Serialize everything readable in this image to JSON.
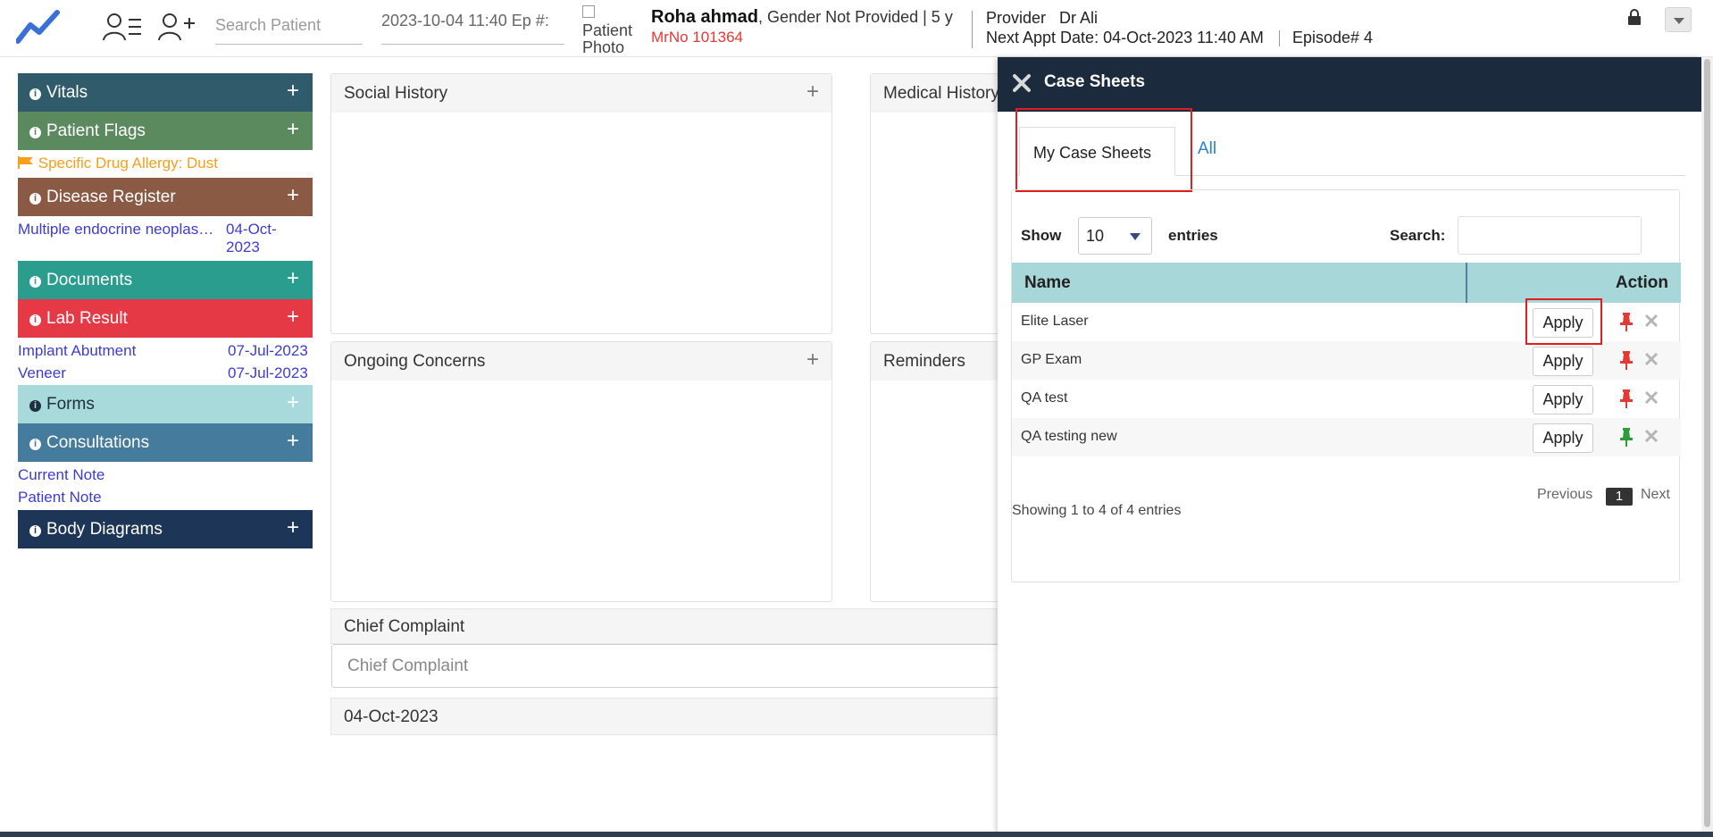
{
  "header": {
    "search_placeholder": "Search Patient",
    "ep_text": "2023-10-04 11:40 Ep #:",
    "photo_alt": "Patient Photo",
    "patient_name": "Roha ahmad",
    "patient_meta": ", Gender Not Provided | 5 y",
    "mrno": "MrNo 101364",
    "provider_label": "Provider",
    "provider_name": "Dr Ali",
    "next_appt": "Next Appt Date: 04-Oct-2023 11:40 AM",
    "episode": "Episode# 4"
  },
  "left": {
    "vitals": "Vitals",
    "flags": "Patient Flags",
    "flag_item": "Specific Drug Allergy: Dust",
    "disease": "Disease Register",
    "disease_item": "Multiple endocrine neoplas…",
    "disease_date": "04-Oct-\n2023",
    "documents": "Documents",
    "lab": "Lab Result",
    "lab_items": [
      {
        "name": "Implant Abutment",
        "date": "07-Jul-2023"
      },
      {
        "name": "Veneer",
        "date": "07-Jul-2023"
      }
    ],
    "forms": "Forms",
    "consult": "Consultations",
    "consult_items": [
      "Current Note",
      "Patient Note"
    ],
    "body": "Body Diagrams",
    "colors": {
      "vitals": "#2f5b6b",
      "flags": "#5b8a5e",
      "disease": "#8b5a45",
      "documents": "#2a9d8f",
      "lab": "#e63946",
      "forms": "#a8dadc",
      "consult": "#457b9d",
      "body": "#1d3557"
    }
  },
  "center": {
    "social": "Social History",
    "medical": "Medical History",
    "ongoing": "Ongoing Concerns",
    "reminders": "Reminders",
    "chief_label": "Chief Complaint",
    "chief_placeholder": "Chief Complaint",
    "date": "04-Oct-2023"
  },
  "drawer": {
    "title": "Case Sheets",
    "tab_my": "My Case Sheets",
    "tab_all": "All",
    "show": "Show",
    "show_value": "10",
    "entries": "entries",
    "search": "Search:",
    "col_name": "Name",
    "col_action": "Action",
    "apply_label": "Apply",
    "rows": [
      {
        "name": "Elite Laser",
        "pin": "red"
      },
      {
        "name": "GP Exam",
        "pin": "red"
      },
      {
        "name": "QA test",
        "pin": "red"
      },
      {
        "name": "QA testing new",
        "pin": "green"
      }
    ],
    "prev": "Previous",
    "page": "1",
    "next": "Next",
    "showing": "Showing 1 to 4 of 4 entries"
  }
}
